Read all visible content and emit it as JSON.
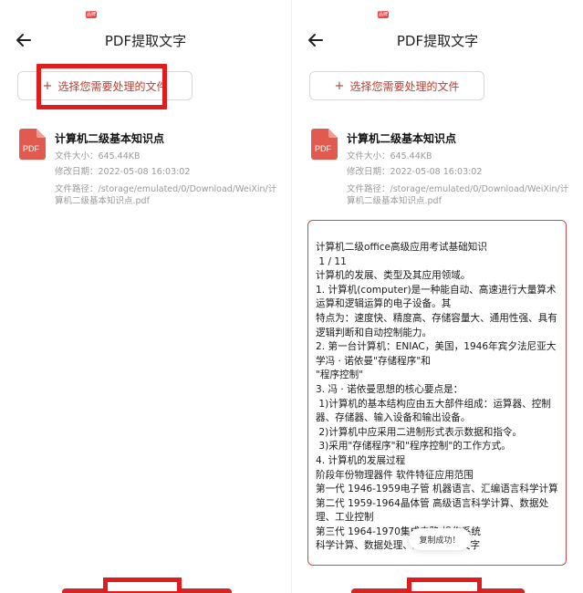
{
  "app": {
    "title": "PDF提取文字",
    "status_badge": "品牌"
  },
  "select_button": {
    "plus": "+",
    "label": "选择您需要处理的文件"
  },
  "file": {
    "icon_label": "PDF",
    "name": "计算机二级基本知识点",
    "size": "文件大小：645.44KB",
    "modified": "修改日期：2022-05-08 16:03:02",
    "path": "文件路径：/storage/emulated/0/Download/WeiXin/计算机二级基本知识点.pdf"
  },
  "extracted_text": "计算机二级office高级应用考试基础知识\n 1 / 11\n计算机的发展、类型及其应用领域。\n1. 计算机(computer)是一种能自动、高速进行大量算术运算和逻辑运算的电子设备。其\n特点为：速度快、精度高、存储容量大、通用性强、具有逻辑判断和自动控制能力。\n2. 第一台计算机：ENIAC，美国，1946年宾夕法尼亚大学冯 · 诺依曼\"存储程序\"和\n\"程序控制\"\n3. 冯 · 诺依曼思想的核心要点是：\n 1)计算机的基本结构应由五大部件组成：运算器、控制器、存储器、输入设备和输出设备。\n 2)计算机中应采用二进制形式表示数据和指令。\n 3)采用\"存储程序\"和\"程序控制\"的工作方式。\n4. 计算机的发展过程\n阶段年份物理器件 软件特征应用范围\n第一代 1946-1959电子管 机器语言、汇编语言科学计算\n第二代 1959-1964晶体管 高级语言科学计算、数据处理、工业控制\n第三代 1964-1970集成电路 操作系统\n科学计算、数据处理、工业控制、文字",
  "toast": "复制成功！",
  "colors": {
    "accent": "#c0392b",
    "highlight": "#e11c1c",
    "pdf_icon": "#e05a4f"
  }
}
